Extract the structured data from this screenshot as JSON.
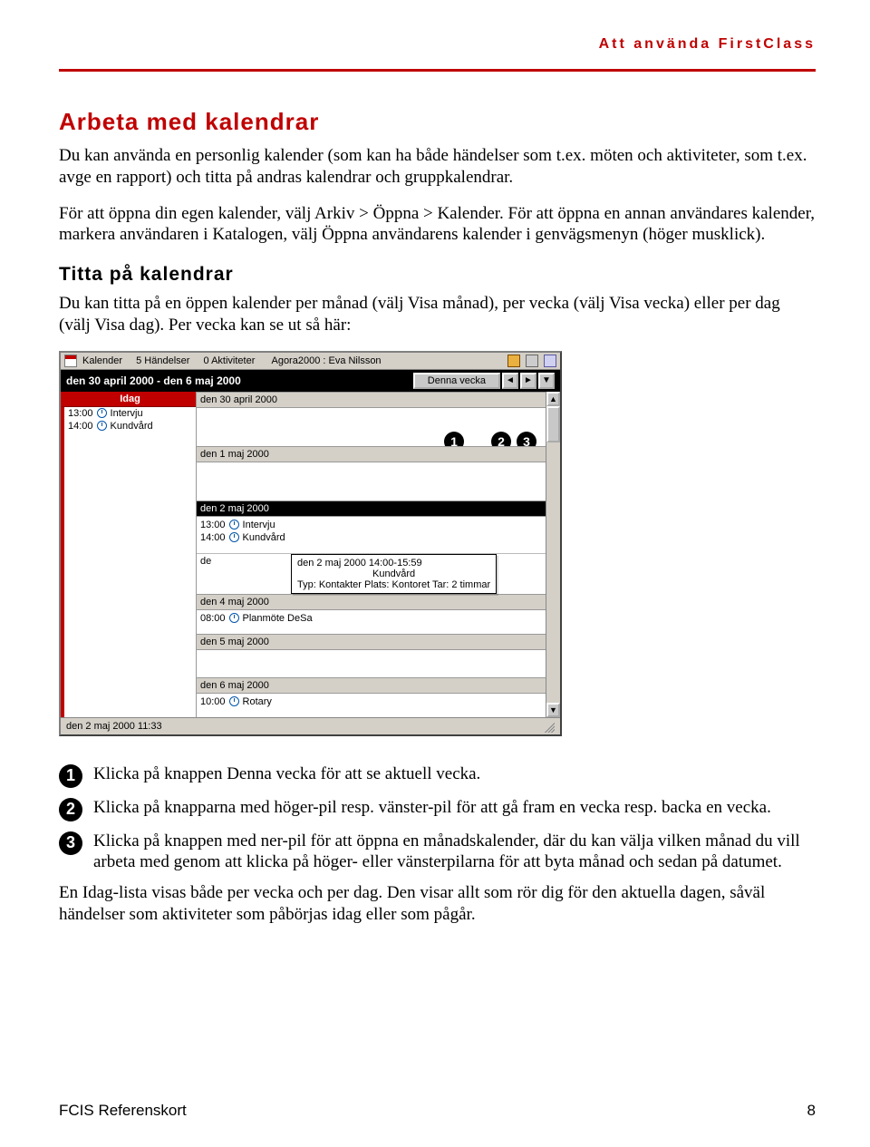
{
  "header_label": "Att använda FirstClass",
  "h1": "Arbeta med kalendrar",
  "p1": "Du kan använda en personlig kalender (som kan ha både händelser som t.ex. möten och aktiviteter, som t.ex. avge en rapport) och titta på andras kalendrar och gruppkalendrar.",
  "p2": "För att öppna din egen kalender, välj Arkiv > Öppna > Kalender. För att öppna en annan användares kalender, markera användaren i Katalogen, välj Öppna användarens kalender i genvägsmenyn (höger musklick).",
  "h2": "Titta på kalendrar",
  "p3": "Du kan titta på en öppen kalender per månad (välj Visa månad), per vecka (välj Visa vecka) eller per dag (välj Visa dag). Per vecka kan se ut så här:",
  "cal": {
    "title_parts": {
      "kalender": "Kalender",
      "handelser": "5 Händelser",
      "aktiviteter": "0 Aktiviteter",
      "agora": "Agora2000 : Eva Nilsson"
    },
    "range": "den 30 april 2000 - den 6 maj 2000",
    "denna_vecka": "Denna vecka",
    "idag_label": "Idag",
    "left": [
      {
        "time": "13:00",
        "label": "Intervju"
      },
      {
        "time": "14:00",
        "label": "Kundvård"
      }
    ],
    "days": [
      {
        "hdr": "den 30 april 2000",
        "rows": []
      },
      {
        "hdr": "den 1 maj 2000",
        "rows": []
      },
      {
        "hdr": "den 2 maj 2000",
        "selected": true,
        "rows": [
          {
            "time": "13:00",
            "label": "Intervju"
          },
          {
            "time": "14:00",
            "label": "Kundvård"
          }
        ]
      },
      {
        "hdr": "den 4 maj 2000",
        "rows": [
          {
            "time": "08:00",
            "label": "Planmöte DeSa"
          }
        ]
      },
      {
        "hdr": "den 5 maj 2000",
        "rows": []
      },
      {
        "hdr": "den 6 maj 2000",
        "rows": [
          {
            "time": "10:00",
            "label": "Rotary"
          }
        ]
      }
    ],
    "de_prefix": "de",
    "tooltip": {
      "line1": "den 2 maj 2000 14:00-15:59",
      "line2": "Kundvård",
      "line3": "Typ: Kontakter Plats: Kontoret Tar: 2 timmar"
    },
    "status": "den 2 maj 2000 11:33"
  },
  "bullets": [
    "Klicka på knappen Denna vecka för att se aktuell vecka.",
    "Klicka på knapparna med höger-pil resp. vänster-pil för att gå fram en vecka resp. backa en vecka.",
    "Klicka på knappen med ner-pil för att öppna en månadskalender, där du kan välja vilken månad du vill arbeta med genom att klicka på höger- eller vänsterpilarna för att byta månad och sedan på datumet."
  ],
  "p4": "En Idag-lista visas både per vecka och per dag. Den visar allt som rör dig för den aktuella dagen, såväl händelser som aktiviteter som påbörjas idag eller som pågår.",
  "footer_left": "FCIS Referenskort",
  "footer_right": "8",
  "nums": [
    "1",
    "2",
    "3",
    "1",
    "2",
    "3"
  ],
  "arrows": {
    "left": "◄",
    "right": "►",
    "down": "▼",
    "up": "▲"
  }
}
